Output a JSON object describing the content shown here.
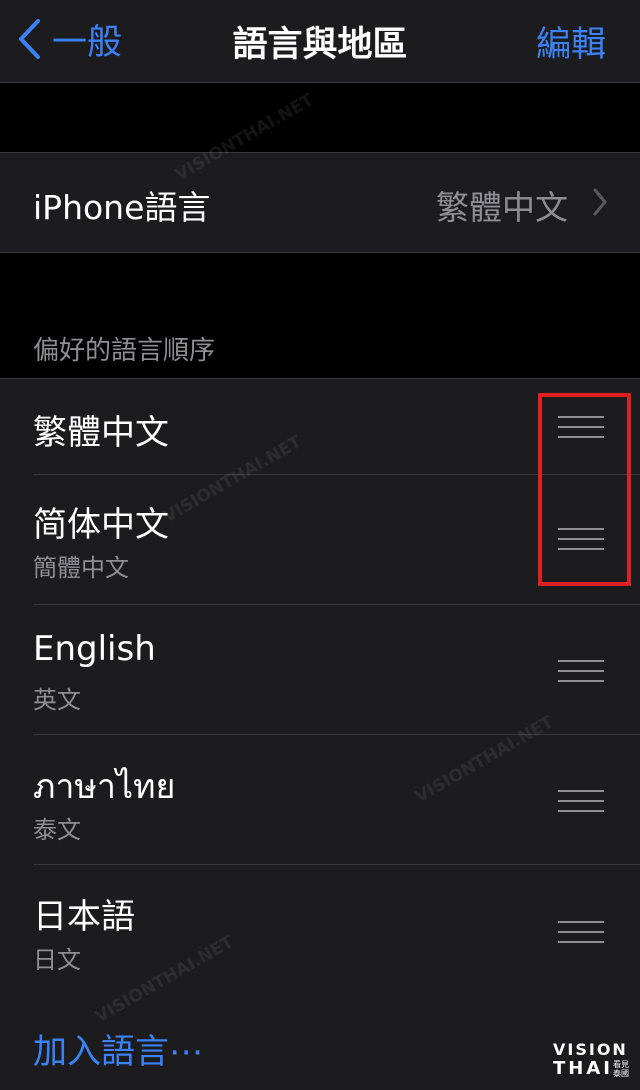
{
  "nav": {
    "back_label": "一般",
    "title": "語言與地區",
    "edit_label": "編輯"
  },
  "iphone_language": {
    "label": "iPhone語言",
    "value": "繁體中文"
  },
  "preferred": {
    "header": "偏好的語言順序",
    "items": [
      {
        "name": "繁體中文",
        "subtitle": ""
      },
      {
        "name": "简体中文",
        "subtitle": "簡體中文"
      },
      {
        "name": "English",
        "subtitle": "英文"
      },
      {
        "name": "ภาษาไทย",
        "subtitle": "泰文"
      },
      {
        "name": "日本語",
        "subtitle": "日文"
      }
    ]
  },
  "add_language_label": "加入語言⋯",
  "logo": {
    "top": "VISION",
    "bottom": "THAI",
    "sub": "看見泰國"
  },
  "watermark": {
    "text": "VISIONTHAI.NET",
    "sub": "看見泰國"
  },
  "colors": {
    "accent": "#3b82f6",
    "highlight": "#e02020",
    "background": "#000000",
    "cell": "#1c1c1e",
    "secondary_text": "#8e8e93"
  }
}
